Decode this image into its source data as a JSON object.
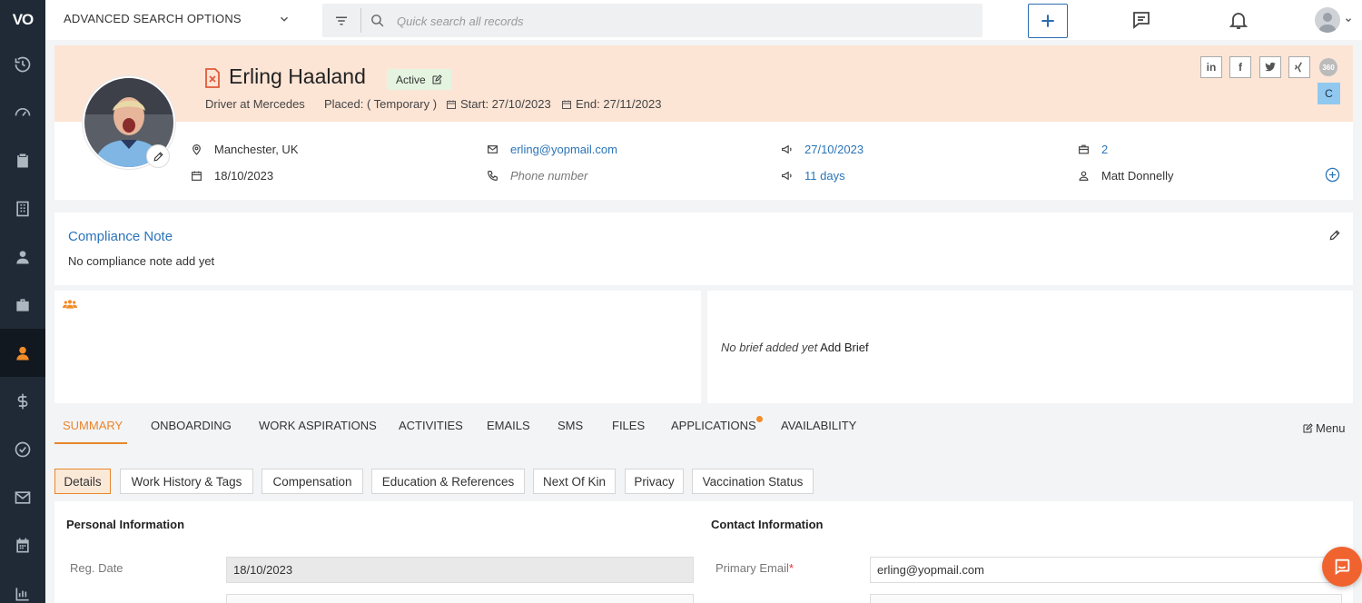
{
  "brand": {
    "logo_text": "VO"
  },
  "topbar": {
    "advanced_search": "ADVANCED SEARCH OPTIONS",
    "search_placeholder": "Quick search all records"
  },
  "sidebar": {
    "items": [
      {
        "icon": "history-icon"
      },
      {
        "icon": "dashboard-icon"
      },
      {
        "icon": "clipboard-icon"
      },
      {
        "icon": "building-icon"
      },
      {
        "icon": "contacts-icon"
      },
      {
        "icon": "briefcase-icon"
      },
      {
        "icon": "candidate-icon",
        "active": true
      },
      {
        "icon": "dollar-icon"
      },
      {
        "icon": "check-circle-icon"
      },
      {
        "icon": "mail-icon"
      },
      {
        "icon": "calendar-icon"
      },
      {
        "icon": "reports-icon"
      }
    ]
  },
  "profile": {
    "name": "Erling Haaland",
    "status": "Active",
    "role": "Driver at Mercedes",
    "placed": "Placed: ( Temporary )",
    "start": "Start: 27/10/2023",
    "end": "End: 27/11/2023",
    "location": "Manchester, UK",
    "date": "18/10/2023",
    "email": "erling@yopmail.com",
    "phone_placeholder": "Phone number",
    "contact_date": "27/10/2023",
    "contact_days": "11 days",
    "jobs_count": "2",
    "owner": "Matt Donnelly",
    "social": [
      "in",
      "f",
      "twitter",
      "xing",
      "360"
    ],
    "badge": "C"
  },
  "compliance": {
    "title": "Compliance Note",
    "text": "No compliance note add yet"
  },
  "brief": {
    "none": "No brief added yet",
    "add": "Add Brief"
  },
  "tabs": [
    "SUMMARY",
    "ONBOARDING",
    "WORK ASPIRATIONS",
    "ACTIVITIES",
    "EMAILS",
    "SMS",
    "FILES",
    "APPLICATIONS",
    "AVAILABILITY"
  ],
  "menu_label": "Menu",
  "subtabs": [
    "Details",
    "Work History & Tags",
    "Compensation",
    "Education & References",
    "Next Of Kin",
    "Privacy",
    "Vaccination Status"
  ],
  "personal": {
    "title": "Personal Information",
    "reg_label": "Reg. Date",
    "reg_value": "18/10/2023"
  },
  "contact": {
    "title": "Contact Information",
    "email_label": "Primary Email",
    "required_mark": "*",
    "email_value": "erling@yopmail.com"
  },
  "colors": {
    "accent": "#e8862c",
    "link": "#2b74b8",
    "sidebar": "#1f2a36",
    "header_bg": "#fde5d6"
  }
}
